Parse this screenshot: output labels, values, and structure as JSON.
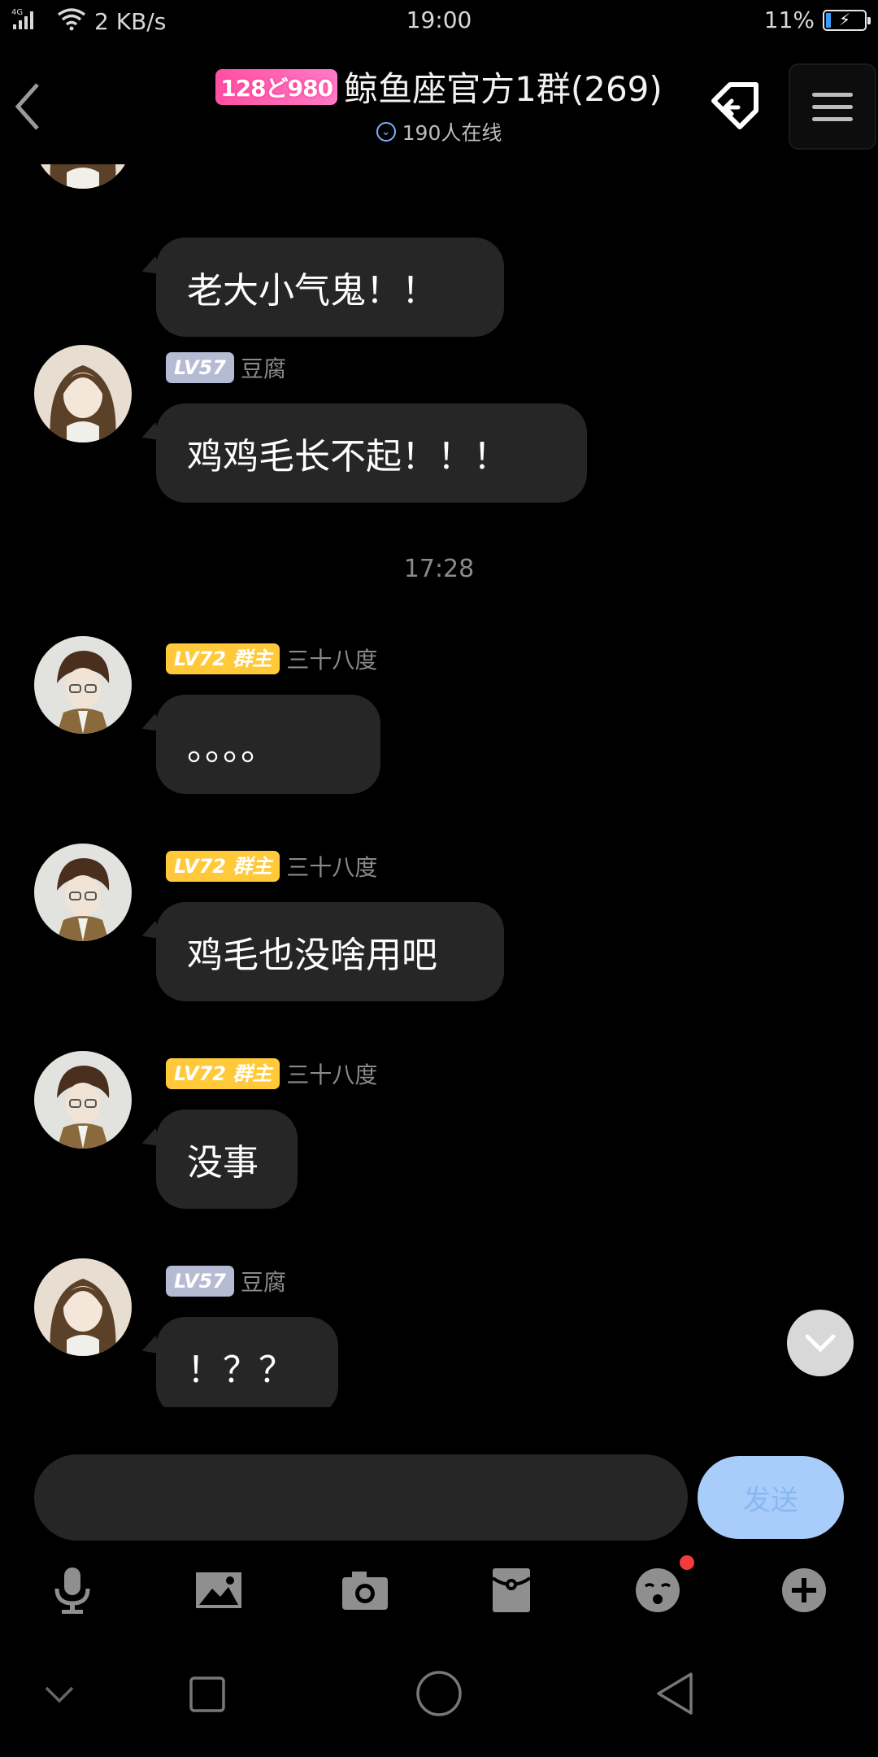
{
  "status_bar": {
    "network": "4G",
    "speed": "2 KB/s",
    "time": "19:00",
    "battery": "11%"
  },
  "header": {
    "logo_text": "128ど980",
    "title": "鲸鱼座官方1群(269)",
    "online": "190人在线"
  },
  "chat": {
    "partial_message": "老大小气鬼！！",
    "messages": [
      {
        "level": "LV57",
        "role": "",
        "name": "豆腐",
        "text": "鸡鸡毛长不起！！！"
      },
      {
        "timestamp": "17:28"
      },
      {
        "level": "LV72",
        "role": "群主",
        "name": "三十八度",
        "text": "。。。。"
      },
      {
        "level": "LV72",
        "role": "群主",
        "name": "三十八度",
        "text": "鸡毛也没啥用吧"
      },
      {
        "level": "LV72",
        "role": "群主",
        "name": "三十八度",
        "text": "没事"
      },
      {
        "level": "LV57",
        "role": "",
        "name": "豆腐",
        "text": "！？？"
      }
    ]
  },
  "composer": {
    "input_value": "",
    "send_label": "发送"
  },
  "toolbar": {
    "icons": [
      "microphone-icon",
      "image-icon",
      "camera-icon",
      "red-packet-icon",
      "emoji-icon",
      "plus-icon"
    ]
  },
  "colors": {
    "background": "#000000",
    "bubble": "#262626",
    "accent_blue": "#a8cdfb",
    "level_gray": "#b4bbd2",
    "level_gold": "#ffc93a"
  }
}
